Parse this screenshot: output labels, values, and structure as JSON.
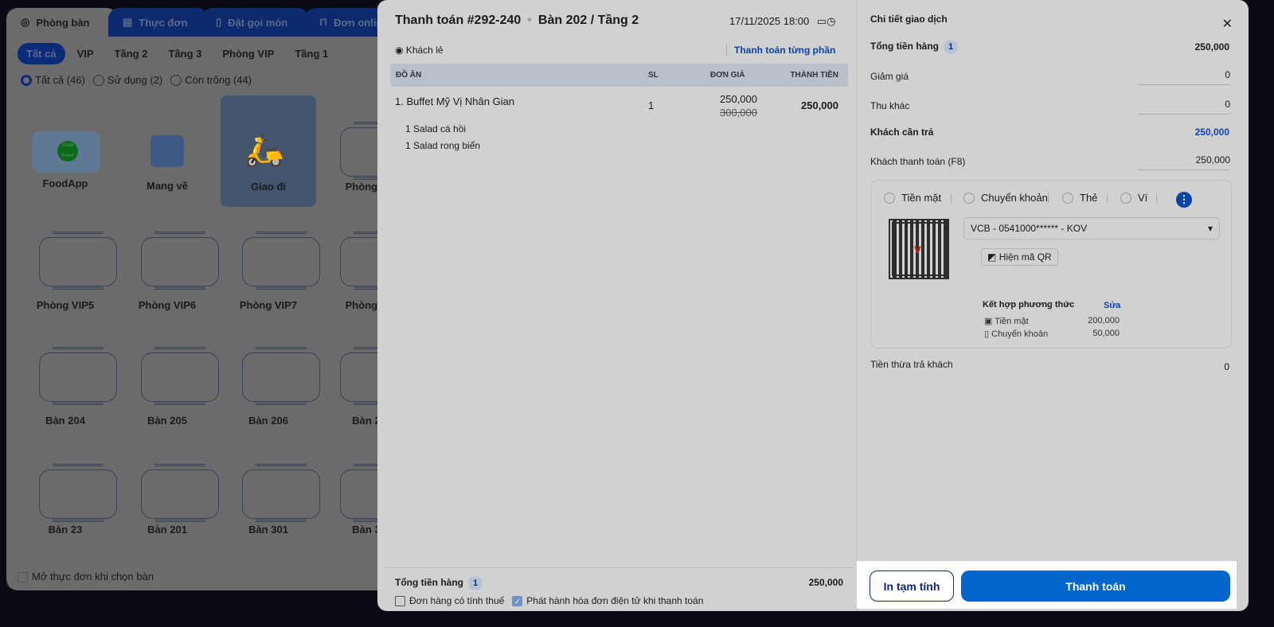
{
  "left": {
    "tabs": [
      {
        "label": "Phòng bàn",
        "icon": "table-icon"
      },
      {
        "label": "Thực đơn",
        "icon": "menu-icon"
      },
      {
        "label": "Đặt gọi món",
        "icon": "phone-order-icon"
      },
      {
        "label": "Đơn online",
        "icon": "bag-icon"
      }
    ],
    "filters": [
      "Tất cả",
      "VIP",
      "Tầng 2",
      "Tầng 3",
      "Phòng VIP",
      "Tầng 1"
    ],
    "status": [
      "Tất cả (46)",
      "Sử dụng (2)",
      "Còn trống (44)"
    ],
    "special": [
      {
        "label": "FoodApp",
        "logo": "Grab Food"
      },
      {
        "label": "Mang về"
      },
      {
        "label": "Giao đi"
      },
      {
        "label": "Phòng V"
      }
    ],
    "tables": [
      "Phòng VIP5",
      "Phòng VIP6",
      "Phòng VIP7",
      "Phòng V",
      "Bàn 204",
      "Bàn 205",
      "Bàn 206",
      "Bàn 2",
      "Bàn 23",
      "Bàn 201",
      "Bàn 301",
      "Bàn 3"
    ],
    "open_menu_label": "Mở thực đơn khi chọn bàn"
  },
  "order": {
    "title": "Thanh toán #292-240",
    "table": "Bàn 202 / Tầng 2",
    "datetime": "17/11/2025 18:00",
    "customer": "Khách lẻ",
    "split_link": "Thanh toán từng phần",
    "columns": [
      "ĐỒ ĂN",
      "SL",
      "ĐƠN GIÁ",
      "THÀNH TIỀN"
    ],
    "items": [
      {
        "name": "1. Buffet Mỹ Vị Nhân Gian",
        "qty": "1",
        "price": "250,000",
        "old_price": "300,000",
        "total": "250,000",
        "subs": [
          "1 Salad cá hồi",
          "1 Salad rong biển"
        ]
      }
    ],
    "footer": {
      "total_label": "Tổng tiền hàng",
      "count": "1",
      "total": "250,000",
      "tax_label": "Đơn hàng có tính thuế",
      "einvoice_label": "Phát hành hóa đơn điện tử khi thanh toán"
    }
  },
  "detail": {
    "title": "Chi tiết giao dịch",
    "total_label": "Tổng tiền hàng",
    "total_count": "1",
    "total": "250,000",
    "discount_label": "Giảm giá",
    "discount": "0",
    "other_label": "Thu khác",
    "other": "0",
    "due_label": "Khách cần trả",
    "due": "250,000",
    "paid_label": "Khách thanh toán (F8)",
    "paid": "250,000",
    "methods": [
      "Tiền mặt",
      "Chuyển khoản",
      "Thẻ",
      "Ví"
    ],
    "account": "VCB - 0541000****** - KOV",
    "show_qr": "Hiện mã QR",
    "combo_label": "Kết hợp phương thức",
    "edit": "Sửa",
    "combo": [
      {
        "label": "Tiền mặt",
        "value": "200,000"
      },
      {
        "label": "Chuyển khoản",
        "value": "50,000"
      }
    ],
    "change_label": "Tiền thừa trả khách",
    "change": "0",
    "print_btn": "In tạm tính",
    "pay_btn": "Thanh toán"
  },
  "colors": {
    "primary": "#0066cc",
    "link": "#0b44a8"
  }
}
